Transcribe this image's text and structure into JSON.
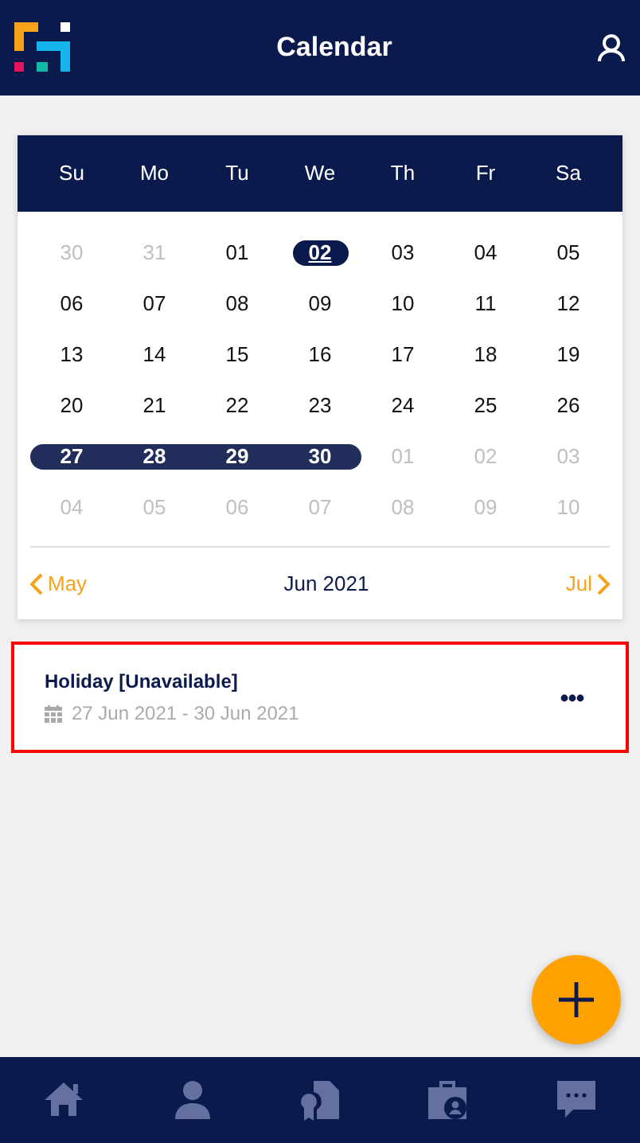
{
  "header": {
    "title": "Calendar"
  },
  "calendar": {
    "weekdays": [
      "Su",
      "Mo",
      "Tu",
      "We",
      "Th",
      "Fr",
      "Sa"
    ],
    "weeks": [
      [
        {
          "label": "30",
          "muted": true,
          "selected": false,
          "in_range": false
        },
        {
          "label": "31",
          "muted": true,
          "selected": false,
          "in_range": false
        },
        {
          "label": "01",
          "muted": false,
          "selected": false,
          "in_range": false
        },
        {
          "label": "02",
          "muted": false,
          "selected": true,
          "in_range": false
        },
        {
          "label": "03",
          "muted": false,
          "selected": false,
          "in_range": false
        },
        {
          "label": "04",
          "muted": false,
          "selected": false,
          "in_range": false
        },
        {
          "label": "05",
          "muted": false,
          "selected": false,
          "in_range": false
        }
      ],
      [
        {
          "label": "06",
          "muted": false,
          "selected": false,
          "in_range": false
        },
        {
          "label": "07",
          "muted": false,
          "selected": false,
          "in_range": false
        },
        {
          "label": "08",
          "muted": false,
          "selected": false,
          "in_range": false
        },
        {
          "label": "09",
          "muted": false,
          "selected": false,
          "in_range": false
        },
        {
          "label": "10",
          "muted": false,
          "selected": false,
          "in_range": false
        },
        {
          "label": "11",
          "muted": false,
          "selected": false,
          "in_range": false
        },
        {
          "label": "12",
          "muted": false,
          "selected": false,
          "in_range": false
        }
      ],
      [
        {
          "label": "13",
          "muted": false,
          "selected": false,
          "in_range": false
        },
        {
          "label": "14",
          "muted": false,
          "selected": false,
          "in_range": false
        },
        {
          "label": "15",
          "muted": false,
          "selected": false,
          "in_range": false
        },
        {
          "label": "16",
          "muted": false,
          "selected": false,
          "in_range": false
        },
        {
          "label": "17",
          "muted": false,
          "selected": false,
          "in_range": false
        },
        {
          "label": "18",
          "muted": false,
          "selected": false,
          "in_range": false
        },
        {
          "label": "19",
          "muted": false,
          "selected": false,
          "in_range": false
        }
      ],
      [
        {
          "label": "20",
          "muted": false,
          "selected": false,
          "in_range": false
        },
        {
          "label": "21",
          "muted": false,
          "selected": false,
          "in_range": false
        },
        {
          "label": "22",
          "muted": false,
          "selected": false,
          "in_range": false
        },
        {
          "label": "23",
          "muted": false,
          "selected": false,
          "in_range": false
        },
        {
          "label": "24",
          "muted": false,
          "selected": false,
          "in_range": false
        },
        {
          "label": "25",
          "muted": false,
          "selected": false,
          "in_range": false
        },
        {
          "label": "26",
          "muted": false,
          "selected": false,
          "in_range": false
        }
      ],
      [
        {
          "label": "27",
          "muted": false,
          "selected": false,
          "in_range": true
        },
        {
          "label": "28",
          "muted": false,
          "selected": false,
          "in_range": true
        },
        {
          "label": "29",
          "muted": false,
          "selected": false,
          "in_range": true
        },
        {
          "label": "30",
          "muted": false,
          "selected": false,
          "in_range": true
        },
        {
          "label": "01",
          "muted": true,
          "selected": false,
          "in_range": false
        },
        {
          "label": "02",
          "muted": true,
          "selected": false,
          "in_range": false
        },
        {
          "label": "03",
          "muted": true,
          "selected": false,
          "in_range": false
        }
      ],
      [
        {
          "label": "04",
          "muted": true,
          "selected": false,
          "in_range": false
        },
        {
          "label": "05",
          "muted": true,
          "selected": false,
          "in_range": false
        },
        {
          "label": "06",
          "muted": true,
          "selected": false,
          "in_range": false
        },
        {
          "label": "07",
          "muted": true,
          "selected": false,
          "in_range": false
        },
        {
          "label": "08",
          "muted": true,
          "selected": false,
          "in_range": false
        },
        {
          "label": "09",
          "muted": true,
          "selected": false,
          "in_range": false
        },
        {
          "label": "10",
          "muted": true,
          "selected": false,
          "in_range": false
        }
      ]
    ],
    "prev": "May",
    "month": "Jun 2021",
    "next": "Jul"
  },
  "events": [
    {
      "title": "Holiday [Unavailable]",
      "dates": "27 Jun 2021 - 30 Jun 2021",
      "highlighted": true
    }
  ],
  "nav": [
    {
      "kind": "home",
      "selected": false
    },
    {
      "kind": "person",
      "selected": false
    },
    {
      "kind": "certificate",
      "selected": false
    },
    {
      "kind": "briefcase",
      "selected": false
    },
    {
      "kind": "chat",
      "selected": false
    }
  ]
}
